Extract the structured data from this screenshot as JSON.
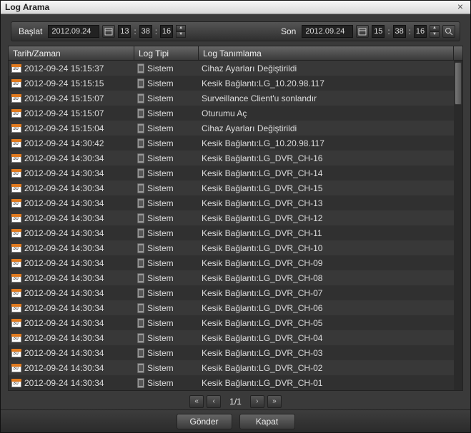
{
  "window": {
    "title": "Log Arama"
  },
  "search": {
    "start_label": "Başlat",
    "end_label": "Son",
    "start_date": "2012.09.24",
    "end_date": "2012.09.24",
    "start_h": "13",
    "start_m": "38",
    "start_s": "16",
    "end_h": "15",
    "end_m": "38",
    "end_s": "16"
  },
  "columns": {
    "c1": "Tarih/Zaman",
    "c2": "Log Tipi",
    "c3": "Log Tanımlama"
  },
  "rows": [
    {
      "time": "2012-09-24 15:15:37",
      "type": "Sistem",
      "desc": "Cihaz Ayarları Değiştirildi"
    },
    {
      "time": "2012-09-24 15:15:15",
      "type": "Sistem",
      "desc": "Kesik Bağlantı:LG_10.20.98.117"
    },
    {
      "time": "2012-09-24 15:15:07",
      "type": "Sistem",
      "desc": "Surveillance Client'u sonlandır"
    },
    {
      "time": "2012-09-24 15:15:07",
      "type": "Sistem",
      "desc": "Oturumu Aç"
    },
    {
      "time": "2012-09-24 15:15:04",
      "type": "Sistem",
      "desc": "Cihaz Ayarları Değiştirildi"
    },
    {
      "time": "2012-09-24 14:30:42",
      "type": "Sistem",
      "desc": "Kesik Bağlantı:LG_10.20.98.117"
    },
    {
      "time": "2012-09-24 14:30:34",
      "type": "Sistem",
      "desc": "Kesik Bağlantı:LG_DVR_CH-16"
    },
    {
      "time": "2012-09-24 14:30:34",
      "type": "Sistem",
      "desc": "Kesik Bağlantı:LG_DVR_CH-14"
    },
    {
      "time": "2012-09-24 14:30:34",
      "type": "Sistem",
      "desc": "Kesik Bağlantı:LG_DVR_CH-15"
    },
    {
      "time": "2012-09-24 14:30:34",
      "type": "Sistem",
      "desc": "Kesik Bağlantı:LG_DVR_CH-13"
    },
    {
      "time": "2012-09-24 14:30:34",
      "type": "Sistem",
      "desc": "Kesik Bağlantı:LG_DVR_CH-12"
    },
    {
      "time": "2012-09-24 14:30:34",
      "type": "Sistem",
      "desc": "Kesik Bağlantı:LG_DVR_CH-11"
    },
    {
      "time": "2012-09-24 14:30:34",
      "type": "Sistem",
      "desc": "Kesik Bağlantı:LG_DVR_CH-10"
    },
    {
      "time": "2012-09-24 14:30:34",
      "type": "Sistem",
      "desc": "Kesik Bağlantı:LG_DVR_CH-09"
    },
    {
      "time": "2012-09-24 14:30:34",
      "type": "Sistem",
      "desc": "Kesik Bağlantı:LG_DVR_CH-08"
    },
    {
      "time": "2012-09-24 14:30:34",
      "type": "Sistem",
      "desc": "Kesik Bağlantı:LG_DVR_CH-07"
    },
    {
      "time": "2012-09-24 14:30:34",
      "type": "Sistem",
      "desc": "Kesik Bağlantı:LG_DVR_CH-06"
    },
    {
      "time": "2012-09-24 14:30:34",
      "type": "Sistem",
      "desc": "Kesik Bağlantı:LG_DVR_CH-05"
    },
    {
      "time": "2012-09-24 14:30:34",
      "type": "Sistem",
      "desc": "Kesik Bağlantı:LG_DVR_CH-04"
    },
    {
      "time": "2012-09-24 14:30:34",
      "type": "Sistem",
      "desc": "Kesik Bağlantı:LG_DVR_CH-03"
    },
    {
      "time": "2012-09-24 14:30:34",
      "type": "Sistem",
      "desc": "Kesik Bağlantı:LG_DVR_CH-02"
    },
    {
      "time": "2012-09-24 14:30:34",
      "type": "Sistem",
      "desc": "Kesik Bağlantı:LG_DVR_CH-01"
    }
  ],
  "pager": {
    "text": "1/1"
  },
  "footer": {
    "submit": "Gönder",
    "close": "Kapat"
  }
}
